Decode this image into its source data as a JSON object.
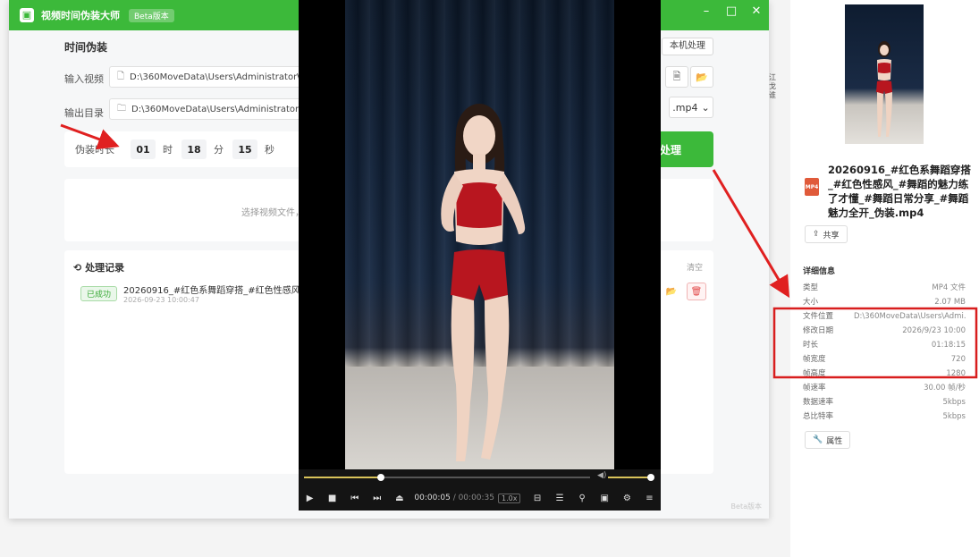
{
  "app": {
    "title": "视频时间伪装大师",
    "version": "Beta版本",
    "window_controls": [
      "minimize",
      "maximize",
      "close"
    ]
  },
  "main": {
    "section_title": "时间伪装",
    "local_process_label": "本机处理",
    "input_video_label": "输入视频",
    "input_video_value": "D:\\360MoveData\\Users\\Administrator\\Desktop",
    "output_dir_label": "输出目录",
    "output_dir_value": "D:\\360MoveData\\Users\\Administrator\\Desktop",
    "format_value": ".mp4",
    "duration_label": "伪装时长",
    "duration_hours": "01",
    "duration_hours_unit": "时",
    "duration_minutes": "18",
    "duration_minutes_unit": "分",
    "duration_seconds": "15",
    "duration_seconds_unit": "秒",
    "process_label": "处理",
    "drop_text": "选择视频文件，"
  },
  "records": {
    "title": "处理记录",
    "clear_label": "清空",
    "items": [
      {
        "status": "已成功",
        "name": "20260916_#红色系舞蹈穿搭_#红色性感风_#舞蹈",
        "time": "2026-09-23 10:00:47"
      }
    ]
  },
  "player": {
    "current_time": "00:00:05",
    "total_time": "/ 00:00:35",
    "speed_badge": "1.0x",
    "progress_fraction": 0.27,
    "volume_fraction": 1.0,
    "buttons": [
      "play-icon",
      "stop-icon",
      "previous-icon",
      "next-icon",
      "eject-icon",
      "subtitle-icon",
      "playlist-icon",
      "zoom-icon",
      "snapshot-icon",
      "settings-icon",
      "menu-icon"
    ]
  },
  "props": {
    "file_name": "20260916_#红色系舞蹈穿搭_#红色性感风_#舞蹈的魅力练了才懂_#舞蹈日常分享_#舞蹈魅力全开_伪装.mp4",
    "share_label": "共享",
    "details_title": "详细信息",
    "details": [
      {
        "k": "类型",
        "v": "MP4 文件"
      },
      {
        "k": "大小",
        "v": "2.07 MB"
      },
      {
        "k": "文件位置",
        "v": "D:\\360MoveData\\Users\\Admi..."
      },
      {
        "k": "修改日期",
        "v": "2026/9/23 10:00"
      },
      {
        "k": "时长",
        "v": "01:18:15"
      },
      {
        "k": "帧宽度",
        "v": "720"
      },
      {
        "k": "帧高度",
        "v": "1280"
      },
      {
        "k": "帧速率",
        "v": "30.00 帧/秒"
      },
      {
        "k": "数据速率",
        "v": "5kbps"
      },
      {
        "k": "总比特率",
        "v": "5kbps"
      }
    ],
    "attr_label": "属性"
  },
  "colors": {
    "brand_green": "#3cb93a",
    "annotation_red": "#e02020",
    "progress_gold": "#d9c35a"
  }
}
